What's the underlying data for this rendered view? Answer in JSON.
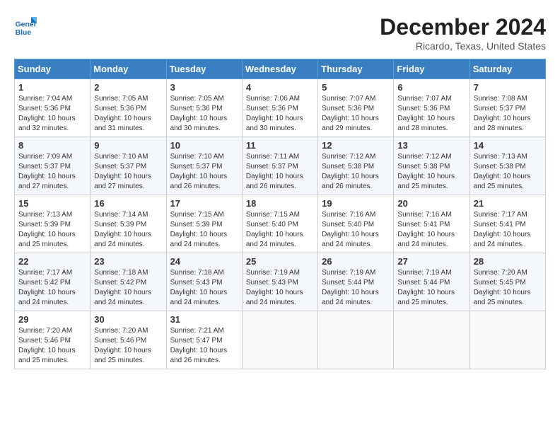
{
  "header": {
    "logo_line1": "General",
    "logo_line2": "Blue",
    "month": "December 2024",
    "location": "Ricardo, Texas, United States"
  },
  "days_of_week": [
    "Sunday",
    "Monday",
    "Tuesday",
    "Wednesday",
    "Thursday",
    "Friday",
    "Saturday"
  ],
  "weeks": [
    [
      {
        "day": "1",
        "sunrise": "7:04 AM",
        "sunset": "5:36 PM",
        "daylight": "10 hours and 32 minutes."
      },
      {
        "day": "2",
        "sunrise": "7:05 AM",
        "sunset": "5:36 PM",
        "daylight": "10 hours and 31 minutes."
      },
      {
        "day": "3",
        "sunrise": "7:05 AM",
        "sunset": "5:36 PM",
        "daylight": "10 hours and 30 minutes."
      },
      {
        "day": "4",
        "sunrise": "7:06 AM",
        "sunset": "5:36 PM",
        "daylight": "10 hours and 30 minutes."
      },
      {
        "day": "5",
        "sunrise": "7:07 AM",
        "sunset": "5:36 PM",
        "daylight": "10 hours and 29 minutes."
      },
      {
        "day": "6",
        "sunrise": "7:07 AM",
        "sunset": "5:36 PM",
        "daylight": "10 hours and 28 minutes."
      },
      {
        "day": "7",
        "sunrise": "7:08 AM",
        "sunset": "5:37 PM",
        "daylight": "10 hours and 28 minutes."
      }
    ],
    [
      {
        "day": "8",
        "sunrise": "7:09 AM",
        "sunset": "5:37 PM",
        "daylight": "10 hours and 27 minutes."
      },
      {
        "day": "9",
        "sunrise": "7:10 AM",
        "sunset": "5:37 PM",
        "daylight": "10 hours and 27 minutes."
      },
      {
        "day": "10",
        "sunrise": "7:10 AM",
        "sunset": "5:37 PM",
        "daylight": "10 hours and 26 minutes."
      },
      {
        "day": "11",
        "sunrise": "7:11 AM",
        "sunset": "5:37 PM",
        "daylight": "10 hours and 26 minutes."
      },
      {
        "day": "12",
        "sunrise": "7:12 AM",
        "sunset": "5:38 PM",
        "daylight": "10 hours and 26 minutes."
      },
      {
        "day": "13",
        "sunrise": "7:12 AM",
        "sunset": "5:38 PM",
        "daylight": "10 hours and 25 minutes."
      },
      {
        "day": "14",
        "sunrise": "7:13 AM",
        "sunset": "5:38 PM",
        "daylight": "10 hours and 25 minutes."
      }
    ],
    [
      {
        "day": "15",
        "sunrise": "7:13 AM",
        "sunset": "5:39 PM",
        "daylight": "10 hours and 25 minutes."
      },
      {
        "day": "16",
        "sunrise": "7:14 AM",
        "sunset": "5:39 PM",
        "daylight": "10 hours and 24 minutes."
      },
      {
        "day": "17",
        "sunrise": "7:15 AM",
        "sunset": "5:39 PM",
        "daylight": "10 hours and 24 minutes."
      },
      {
        "day": "18",
        "sunrise": "7:15 AM",
        "sunset": "5:40 PM",
        "daylight": "10 hours and 24 minutes."
      },
      {
        "day": "19",
        "sunrise": "7:16 AM",
        "sunset": "5:40 PM",
        "daylight": "10 hours and 24 minutes."
      },
      {
        "day": "20",
        "sunrise": "7:16 AM",
        "sunset": "5:41 PM",
        "daylight": "10 hours and 24 minutes."
      },
      {
        "day": "21",
        "sunrise": "7:17 AM",
        "sunset": "5:41 PM",
        "daylight": "10 hours and 24 minutes."
      }
    ],
    [
      {
        "day": "22",
        "sunrise": "7:17 AM",
        "sunset": "5:42 PM",
        "daylight": "10 hours and 24 minutes."
      },
      {
        "day": "23",
        "sunrise": "7:18 AM",
        "sunset": "5:42 PM",
        "daylight": "10 hours and 24 minutes."
      },
      {
        "day": "24",
        "sunrise": "7:18 AM",
        "sunset": "5:43 PM",
        "daylight": "10 hours and 24 minutes."
      },
      {
        "day": "25",
        "sunrise": "7:19 AM",
        "sunset": "5:43 PM",
        "daylight": "10 hours and 24 minutes."
      },
      {
        "day": "26",
        "sunrise": "7:19 AM",
        "sunset": "5:44 PM",
        "daylight": "10 hours and 24 minutes."
      },
      {
        "day": "27",
        "sunrise": "7:19 AM",
        "sunset": "5:44 PM",
        "daylight": "10 hours and 25 minutes."
      },
      {
        "day": "28",
        "sunrise": "7:20 AM",
        "sunset": "5:45 PM",
        "daylight": "10 hours and 25 minutes."
      }
    ],
    [
      {
        "day": "29",
        "sunrise": "7:20 AM",
        "sunset": "5:46 PM",
        "daylight": "10 hours and 25 minutes."
      },
      {
        "day": "30",
        "sunrise": "7:20 AM",
        "sunset": "5:46 PM",
        "daylight": "10 hours and 25 minutes."
      },
      {
        "day": "31",
        "sunrise": "7:21 AM",
        "sunset": "5:47 PM",
        "daylight": "10 hours and 26 minutes."
      },
      null,
      null,
      null,
      null
    ]
  ],
  "labels": {
    "sunrise": "Sunrise:",
    "sunset": "Sunset:",
    "daylight": "Daylight:"
  }
}
